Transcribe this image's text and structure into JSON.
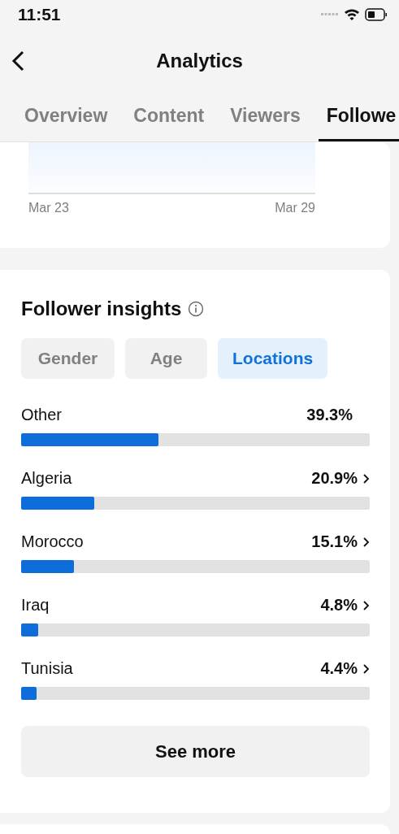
{
  "status_bar": {
    "time": "11:51"
  },
  "header": {
    "title": "Analytics"
  },
  "tabs": [
    {
      "label": "Overview",
      "selected": false
    },
    {
      "label": "Content",
      "selected": false
    },
    {
      "label": "Viewers",
      "selected": false
    },
    {
      "label": "Followe",
      "selected": true
    }
  ],
  "chart_card": {
    "x_labels": [
      "Mar 23",
      "Mar 29"
    ]
  },
  "insights": {
    "title": "Follower insights",
    "filters": [
      {
        "label": "Gender",
        "selected": false
      },
      {
        "label": "Age",
        "selected": false
      },
      {
        "label": "Locations",
        "selected": true
      }
    ],
    "locations": [
      {
        "name": "Other",
        "share": "39.3%",
        "level": 0.393,
        "chevron": false
      },
      {
        "name": "Algeria",
        "share": "20.9%",
        "level": 0.209,
        "chevron": true
      },
      {
        "name": "Morocco",
        "share": "15.1%",
        "level": 0.151,
        "chevron": true
      },
      {
        "name": "Iraq",
        "share": "4.8%",
        "level": 0.048,
        "chevron": true
      },
      {
        "name": "Tunisia",
        "share": "4.4%",
        "level": 0.044,
        "chevron": true
      }
    ],
    "button": "See more"
  }
}
